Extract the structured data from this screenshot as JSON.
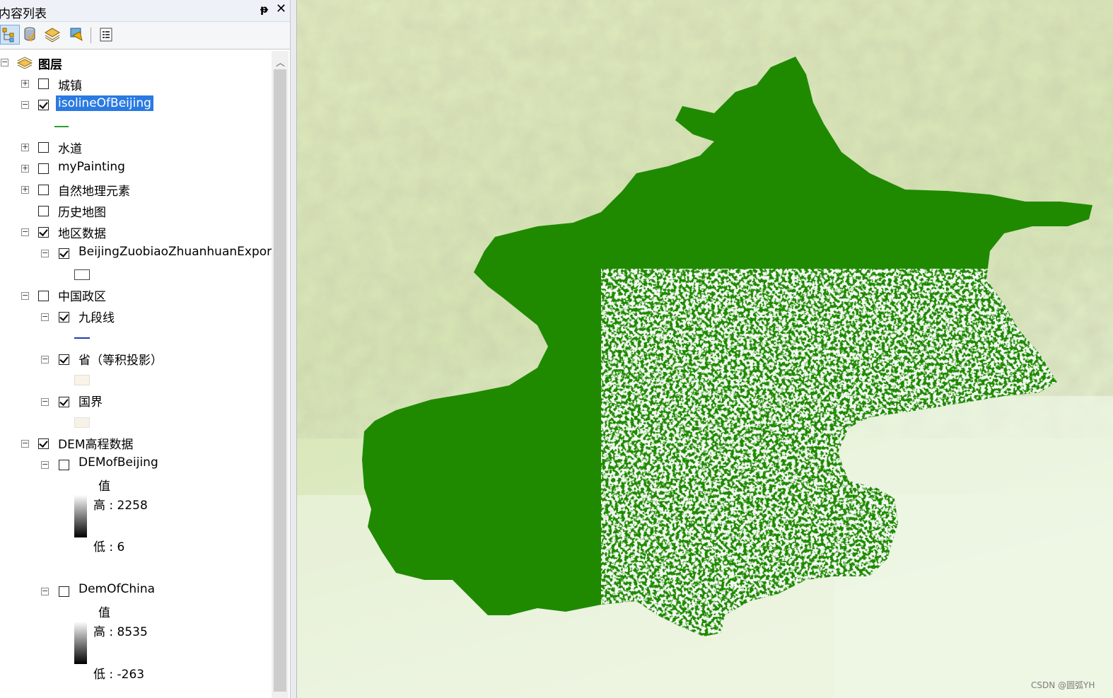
{
  "panel": {
    "title": "内容列表",
    "pin_glyph": "ᵽ",
    "close_glyph": "✕"
  },
  "toolbar": {
    "buttons": [
      {
        "name": "list-by-drawing-order",
        "icon": "drawing-order-icon",
        "active": true
      },
      {
        "name": "list-by-source",
        "icon": "database-icon",
        "active": false
      },
      {
        "name": "list-by-visibility",
        "icon": "layers-visibility-icon",
        "active": false
      },
      {
        "name": "list-by-selection",
        "icon": "selection-icon",
        "active": false
      },
      {
        "name": "options",
        "icon": "options-list-icon",
        "active": false
      }
    ]
  },
  "tree": {
    "root_label": "图层",
    "layers": {
      "chengzhen": {
        "label": "城镇",
        "checked": false,
        "expander": "+"
      },
      "isoline": {
        "label": "isolineOfBeijing",
        "checked": true,
        "expander": "−",
        "selected": true
      },
      "shuidao": {
        "label": "水道",
        "checked": false,
        "expander": "+"
      },
      "mypainting": {
        "label": "myPainting",
        "checked": false,
        "expander": "+"
      },
      "ziran": {
        "label": "自然地理元素",
        "checked": false,
        "expander": "+"
      },
      "lishi": {
        "label": "历史地图",
        "checked": false
      },
      "diqu": {
        "label": "地区数据",
        "checked": true,
        "expander": "−"
      },
      "beijing_zb": {
        "label": "BeijingZuobiaoZhuanhuanExport",
        "checked": true,
        "expander": "−"
      },
      "zhongguo": {
        "label": "中国政区",
        "checked": false,
        "expander": "−"
      },
      "jiuduanxian": {
        "label": "九段线",
        "checked": true,
        "expander": "−"
      },
      "sheng": {
        "label": "省（等积投影）",
        "checked": true,
        "expander": "−"
      },
      "guojie": {
        "label": "国界",
        "checked": true,
        "expander": "−"
      },
      "dem": {
        "label": "DEM高程数据",
        "checked": true,
        "expander": "−"
      },
      "demofbeijing": {
        "label": "DEMofBeijing",
        "checked": false,
        "expander": "−",
        "value_title": "值",
        "high": "高 : 2258",
        "low": "低 : 6"
      },
      "demofchina": {
        "label": "DemOfChina",
        "checked": false,
        "expander": "−",
        "value_title": "值",
        "high": "高 : 8535",
        "low": "低 : -263"
      }
    },
    "swatch_colors": {
      "isoline": "#2ca02c",
      "jiuduanxian": "#1f3fa8",
      "sheng": "#fbf3ea",
      "guojie": "#f6f2ea",
      "beijing_outline": "#444444"
    }
  },
  "map": {
    "fill_color": "#1f8a00",
    "background_colors": [
      "#e6efc7",
      "#d5e5b0",
      "#eef5e2"
    ]
  },
  "watermark": "CSDN @圆弧YH"
}
